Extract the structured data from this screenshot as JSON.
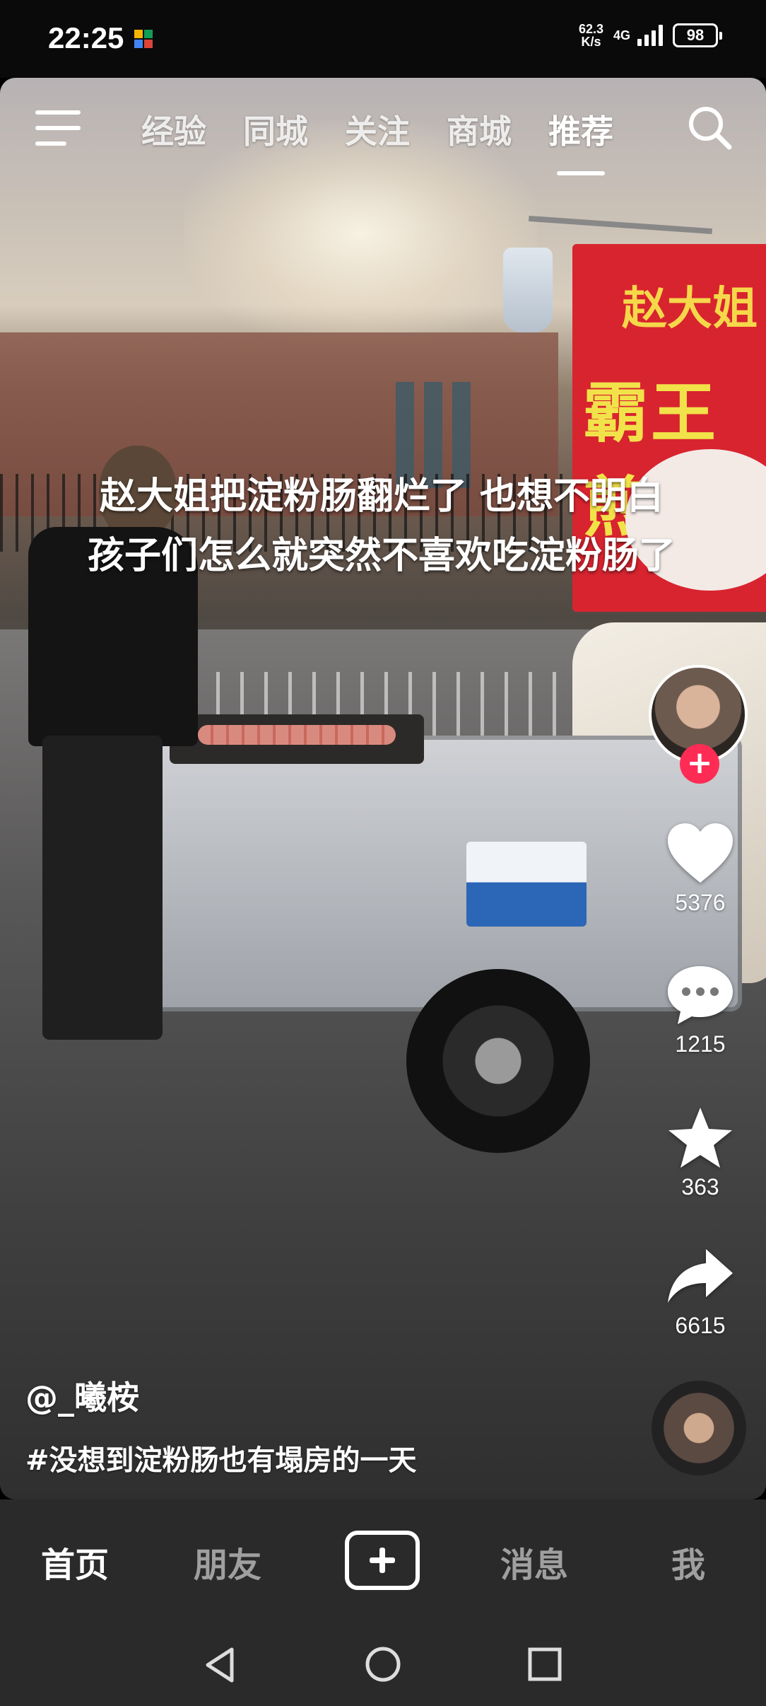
{
  "status_bar": {
    "time": "22:25",
    "net_speed_value": "62.3",
    "net_speed_unit": "K/s",
    "network_type": "4G",
    "battery": "98"
  },
  "top_nav": {
    "tabs": [
      "经验",
      "同城",
      "关注",
      "商城",
      "推荐"
    ],
    "active_tab": "推荐",
    "menu_icon": "menu-icon",
    "search_icon": "search-icon"
  },
  "video": {
    "subtitle": "赵大姐把淀粉肠翻烂了 也想不明白 孩子们怎么就突然不喜欢吃淀粉肠了",
    "sign_text_1": "赵大姐",
    "sign_text_2": "霸王煎"
  },
  "sidebar": {
    "likes": "5376",
    "comments": "1215",
    "favorites": "363",
    "shares": "6615",
    "follow_label": "+"
  },
  "caption": {
    "author": "@_曦桉",
    "hashtag": "#没想到淀粉肠也有塌房的一天"
  },
  "bottom_nav": {
    "home": "首页",
    "friends": "朋友",
    "messages": "消息",
    "me": "我",
    "active": "首页"
  },
  "colors": {
    "accent": "#fe2c55",
    "nav_bg": "#2a2a2a",
    "sign_red": "#d8242f"
  }
}
